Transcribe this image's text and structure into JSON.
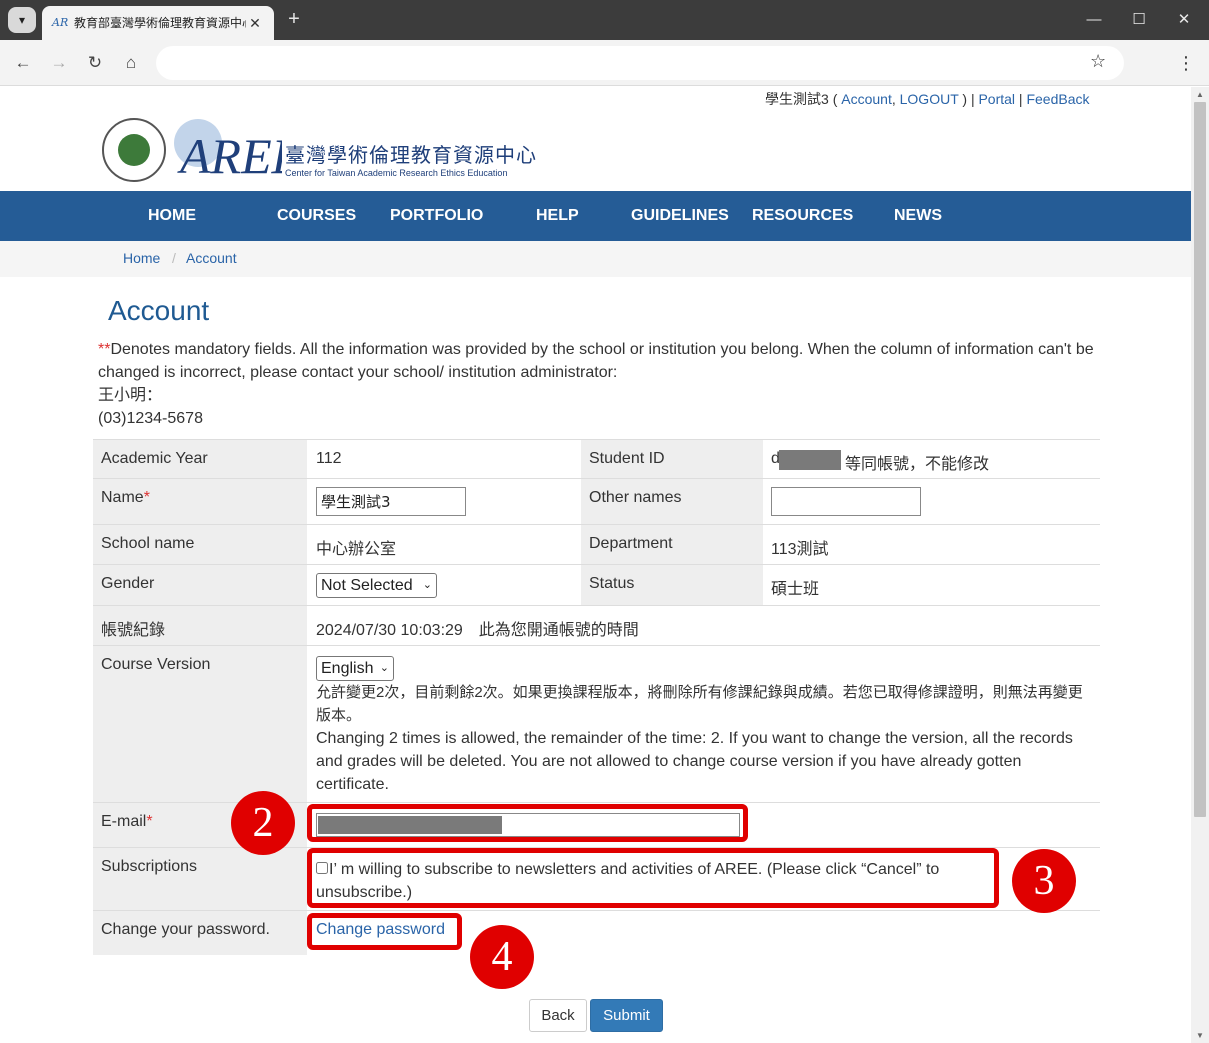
{
  "browser": {
    "tab_title": "教育部臺灣學術倫理教育資源中心",
    "tab_close": "✕",
    "new_tab": "+",
    "address_value": ""
  },
  "header": {
    "user_name": "學生測試3",
    "account_link": "Account",
    "logout_link": "LOGOUT",
    "portal_link": "Portal",
    "feedback_link": "FeedBack",
    "logo_cn": "臺灣學術倫理教育資源中心",
    "logo_en": "Center for Taiwan Academic Research Ethics Education",
    "logo_mark": "AREE"
  },
  "nav": {
    "items": [
      "HOME",
      "COURSES",
      "PORTFOLIO",
      "HELP",
      "GUIDELINES",
      "RESOURCES",
      "NEWS"
    ]
  },
  "breadcrumb": {
    "home": "Home",
    "separator": "/",
    "current": "Account"
  },
  "main": {
    "title": "Account",
    "notice_marker": "**",
    "notice": "Denotes mandatory fields. All the information was provided by the school or institution you belong. When the column of information can't be changed is incorrect, please contact your school/ institution administrator:",
    "contact_name": "王小明：",
    "contact_phone": "(03)1234-5678"
  },
  "form": {
    "academic_year_label": "Academic Year",
    "academic_year": "112",
    "student_id_label": "Student ID",
    "student_id_prefix": "d",
    "student_id_note": "等同帳號，不能修改",
    "name_label": "Name",
    "name_value": "學生測試3",
    "other_names_label": "Other names",
    "other_names_value": "",
    "school_label": "School name",
    "school_value": "中心辦公室",
    "department_label": "Department",
    "department_value": "113測試",
    "gender_label": "Gender",
    "gender_value": "Not Selected",
    "status_label": "Status",
    "status_value": "碩士班",
    "account_log_label": "帳號紀錄",
    "account_log_value": "2024/07/30 10:03:29　此為您開通帳號的時間",
    "course_version_label": "Course Version",
    "course_version_value": "English",
    "course_version_note_cn": "允許變更2次，目前剩餘2次。如果更換課程版本，將刪除所有修課紀錄與成績。若您已取得修課證明，則無法再變更版本。",
    "course_version_note_en": "Changing 2 times is allowed, the remainder of the time: 2. If you want to change the version, all the records and grades will be deleted. You are not allowed to change course version if you have already gotten certificate.",
    "email_label": "E-mail",
    "required_mark": "*",
    "subscriptions_label": "Subscriptions",
    "subscription_text": "I’ m willing to subscribe to newsletters and activities of AREE. (Please click “Cancel” to unsubscribe.)",
    "subscription_checked": false,
    "change_password_label": "Change your password.",
    "change_password_link": "Change password"
  },
  "buttons": {
    "back": "Back",
    "submit": "Submit"
  },
  "callouts": [
    "2",
    "3",
    "4"
  ],
  "colors": {
    "navbar": "#255c96",
    "link": "#2a64a8",
    "title": "#1f5a92",
    "callout": "#e00000",
    "submit": "#337ab7"
  }
}
